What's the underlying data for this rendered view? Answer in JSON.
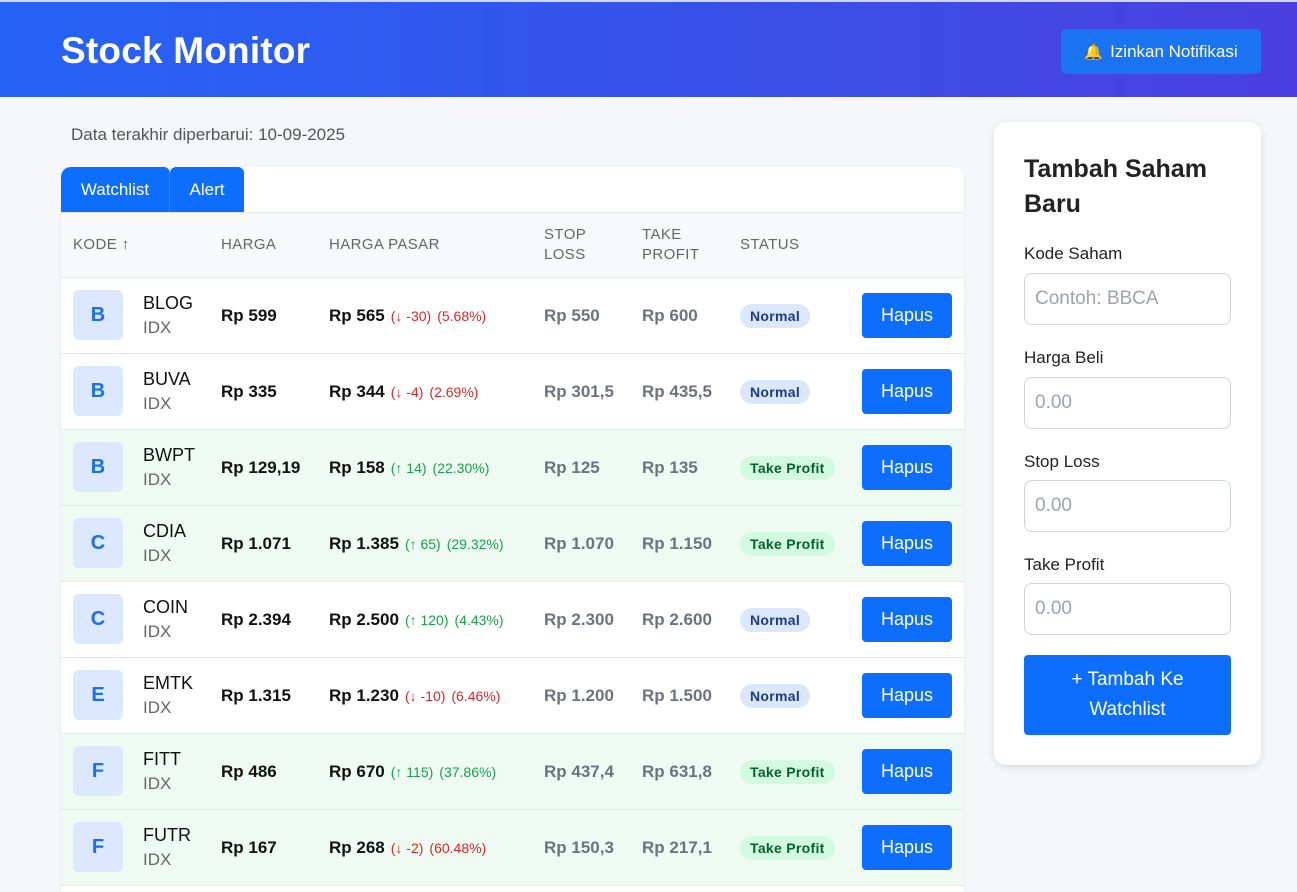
{
  "header": {
    "title": "Stock Monitor",
    "notif_label": "Izinkan Notifikasi",
    "notif_icon": "bell-icon"
  },
  "updated_text": "Data terakhir diperbarui: 10-09-2025",
  "tabs": [
    {
      "label": "Watchlist",
      "active": true
    },
    {
      "label": "Alert",
      "active": false
    }
  ],
  "table": {
    "headers": {
      "kode": "KODE ↑",
      "harga": "HARGA",
      "harga_pasar": "HARGA PASAR",
      "stop_loss_1": "STOP",
      "stop_loss_2": "LOSS",
      "take_profit_1": "TAKE",
      "take_profit_2": "PROFIT",
      "status": "STATUS"
    },
    "delete_label": "Hapus",
    "rows": [
      {
        "initial": "B",
        "code": "BLOG",
        "exchange": "IDX",
        "price": "Rp 599",
        "market": "Rp 565",
        "change": "(↓ -30)",
        "pct": "(5.68%)",
        "dir": "down",
        "stop_loss": "Rp 550",
        "take_profit": "Rp 600",
        "status": "Normal",
        "status_type": "normal"
      },
      {
        "initial": "B",
        "code": "BUVA",
        "exchange": "IDX",
        "price": "Rp 335",
        "market": "Rp 344",
        "change": "(↓ -4)",
        "pct": "(2.69%)",
        "dir": "down",
        "stop_loss": "Rp 301,5",
        "take_profit": "Rp 435,5",
        "status": "Normal",
        "status_type": "normal"
      },
      {
        "initial": "B",
        "code": "BWPT",
        "exchange": "IDX",
        "price": "Rp 129,19",
        "market": "Rp 158",
        "change": "(↑ 14)",
        "pct": "(22.30%)",
        "dir": "up",
        "stop_loss": "Rp 125",
        "take_profit": "Rp 135",
        "status": "Take Profit",
        "status_type": "takeprofit"
      },
      {
        "initial": "C",
        "code": "CDIA",
        "exchange": "IDX",
        "price": "Rp 1.071",
        "market": "Rp 1.385",
        "change": "(↑ 65)",
        "pct": "(29.32%)",
        "dir": "up",
        "stop_loss": "Rp 1.070",
        "take_profit": "Rp 1.150",
        "status": "Take Profit",
        "status_type": "takeprofit"
      },
      {
        "initial": "C",
        "code": "COIN",
        "exchange": "IDX",
        "price": "Rp 2.394",
        "market": "Rp 2.500",
        "change": "(↑ 120)",
        "pct": "(4.43%)",
        "dir": "up",
        "stop_loss": "Rp 2.300",
        "take_profit": "Rp 2.600",
        "status": "Normal",
        "status_type": "normal"
      },
      {
        "initial": "E",
        "code": "EMTK",
        "exchange": "IDX",
        "price": "Rp 1.315",
        "market": "Rp 1.230",
        "change": "(↓ -10)",
        "pct": "(6.46%)",
        "dir": "down",
        "stop_loss": "Rp 1.200",
        "take_profit": "Rp 1.500",
        "status": "Normal",
        "status_type": "normal"
      },
      {
        "initial": "F",
        "code": "FITT",
        "exchange": "IDX",
        "price": "Rp 486",
        "market": "Rp 670",
        "change": "(↑ 115)",
        "pct": "(37.86%)",
        "dir": "up",
        "stop_loss": "Rp 437,4",
        "take_profit": "Rp 631,8",
        "status": "Take Profit",
        "status_type": "takeprofit"
      },
      {
        "initial": "F",
        "code": "FUTR",
        "exchange": "IDX",
        "price": "Rp 167",
        "market": "Rp 268",
        "change": "(↓ -2)",
        "pct": "(60.48%)",
        "dir": "down",
        "stop_loss": "Rp 150,3",
        "take_profit": "Rp 217,1",
        "status": "Take Profit",
        "status_type": "takeprofit"
      }
    ]
  },
  "form": {
    "title": "Tambah Saham Baru",
    "kode_label": "Kode Saham",
    "kode_placeholder": "Contoh: BBCA",
    "harga_label": "Harga Beli",
    "harga_placeholder": "0.00",
    "sl_label": "Stop Loss",
    "sl_placeholder": "0.00",
    "tp_label": "Take Profit",
    "tp_placeholder": "0.00",
    "submit_label": "+ Tambah Ke Watchlist"
  },
  "colors": {
    "primary": "#0d6efd",
    "header_start": "#2563f6",
    "header_end": "#4b3fe0",
    "down": "#dc2626",
    "up": "#16a34a"
  }
}
